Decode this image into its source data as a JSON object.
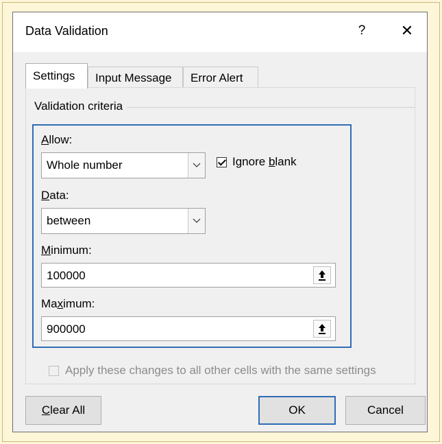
{
  "dialog": {
    "title": "Data Validation",
    "help_glyph": "?",
    "close_glyph": "✕"
  },
  "tabs": [
    {
      "label": "Settings",
      "active": true
    },
    {
      "label": "Input Message",
      "active": false
    },
    {
      "label": "Error Alert",
      "active": false
    }
  ],
  "settings": {
    "group_label": "Validation criteria",
    "allow": {
      "label_hotkey": "A",
      "label_rest": "llow:",
      "value": "Whole number"
    },
    "ignore_blank": {
      "label_before": "Ignore ",
      "label_hotkey": "b",
      "label_after": "lank",
      "checked": true
    },
    "data": {
      "label_hotkey": "D",
      "label_rest": "ata:",
      "value": "between"
    },
    "minimum": {
      "label_hotkey": "M",
      "label_rest": "inimum:",
      "value": "100000"
    },
    "maximum": {
      "label_before": "Ma",
      "label_hotkey": "x",
      "label_after": "imum:",
      "value": "900000"
    },
    "apply_all": {
      "label": "Apply these changes to all other cells with the same settings",
      "checked": false,
      "enabled": false
    }
  },
  "buttons": {
    "clear_all_hotkey": "C",
    "clear_all_rest": "lear All",
    "ok": "OK",
    "cancel": "Cancel"
  },
  "icons": {
    "help": "question-mark-icon",
    "close": "close-icon",
    "dropdown": "chevron-down-icon",
    "range_select": "collapse-dialog-arrow-icon"
  },
  "colors": {
    "focus_border": "#2e6db4",
    "page_background": "#fdf6d8"
  }
}
